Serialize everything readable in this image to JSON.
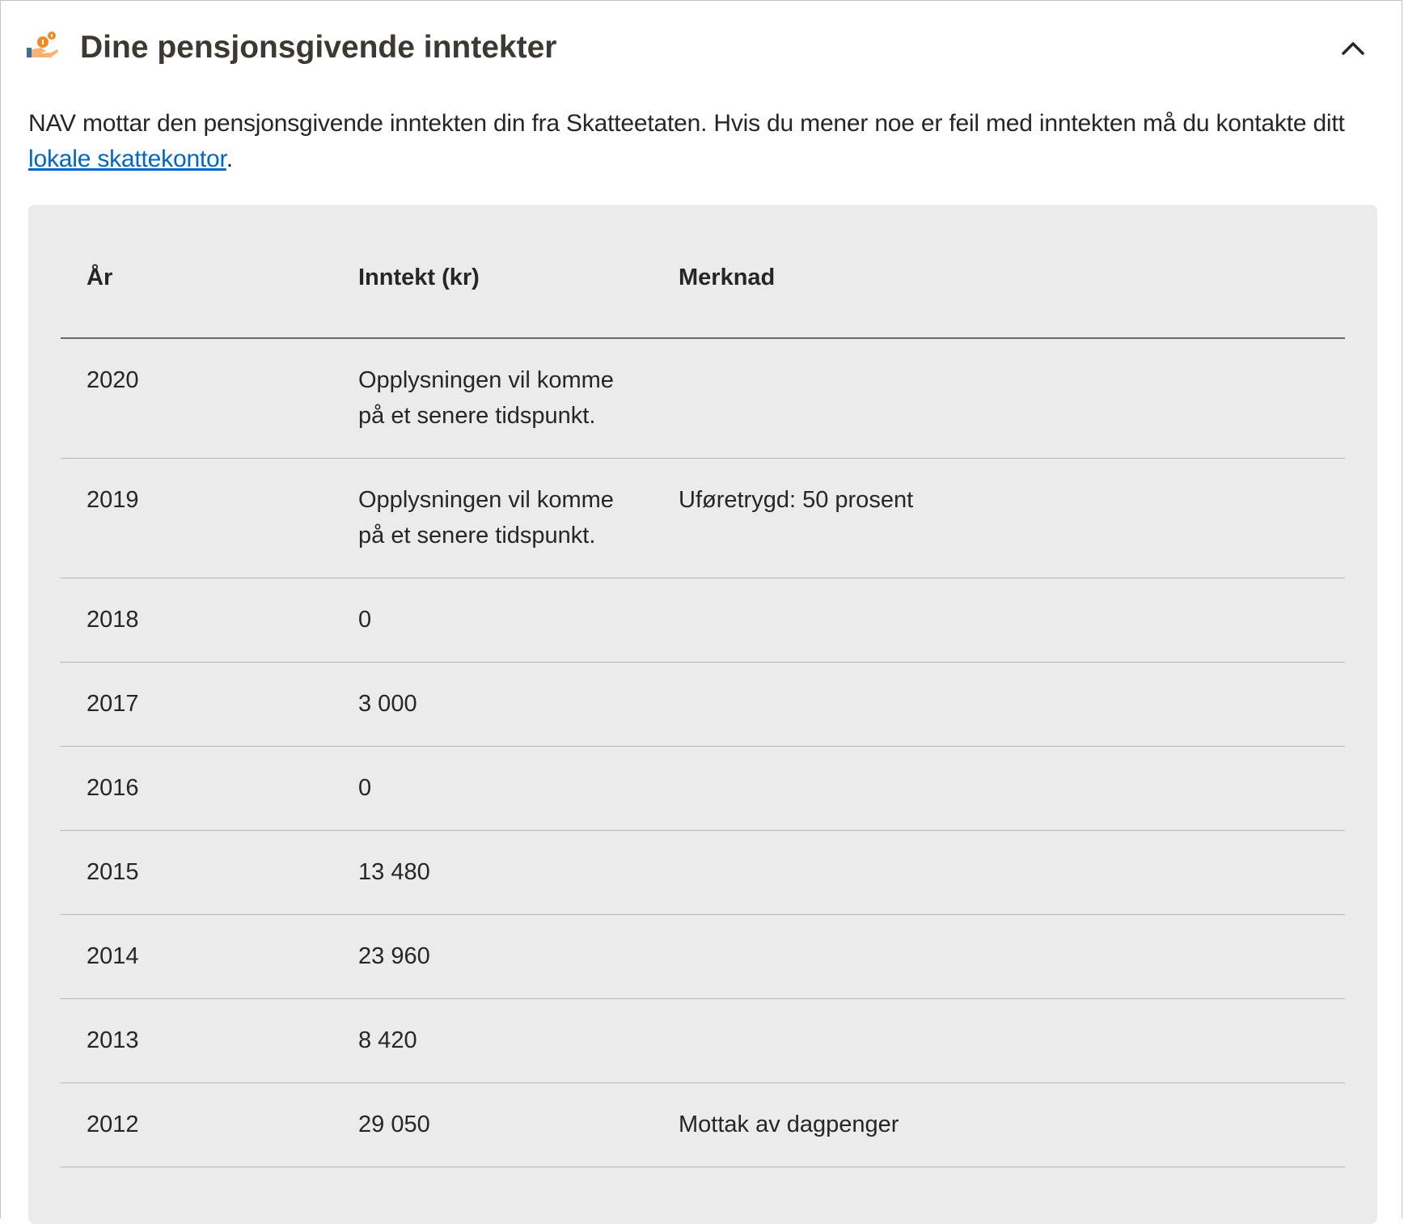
{
  "header": {
    "title": "Dine pensjonsgivende inntekter",
    "icon": "coin-hand-icon",
    "toggle_icon": "chevron-up-icon"
  },
  "intro": {
    "text_before_link": "NAV mottar den pensjonsgivende inntekten din fra Skatteetaten. Hvis du mener noe er feil med inntekten må du kontakte ditt ",
    "link_text": "lokale skattekontor",
    "text_after_link": "."
  },
  "table": {
    "headers": [
      "År",
      "Inntekt (kr)",
      "Merknad"
    ],
    "rows": [
      {
        "year": "2020",
        "income": "Opplysningen vil komme på et senere tidspunkt.",
        "note": ""
      },
      {
        "year": "2019",
        "income": "Opplysningen vil komme på et senere tidspunkt.",
        "note": "Uføretrygd: 50 prosent"
      },
      {
        "year": "2018",
        "income": "0",
        "note": ""
      },
      {
        "year": "2017",
        "income": "3 000",
        "note": ""
      },
      {
        "year": "2016",
        "income": "0",
        "note": ""
      },
      {
        "year": "2015",
        "income": "13 480",
        "note": ""
      },
      {
        "year": "2014",
        "income": "23 960",
        "note": ""
      },
      {
        "year": "2013",
        "income": "8 420",
        "note": ""
      },
      {
        "year": "2012",
        "income": "29 050",
        "note": "Mottak av dagpenger"
      }
    ]
  },
  "colors": {
    "link": "#0067c5",
    "table_background": "#ebebeb",
    "title": "#3e3832"
  }
}
